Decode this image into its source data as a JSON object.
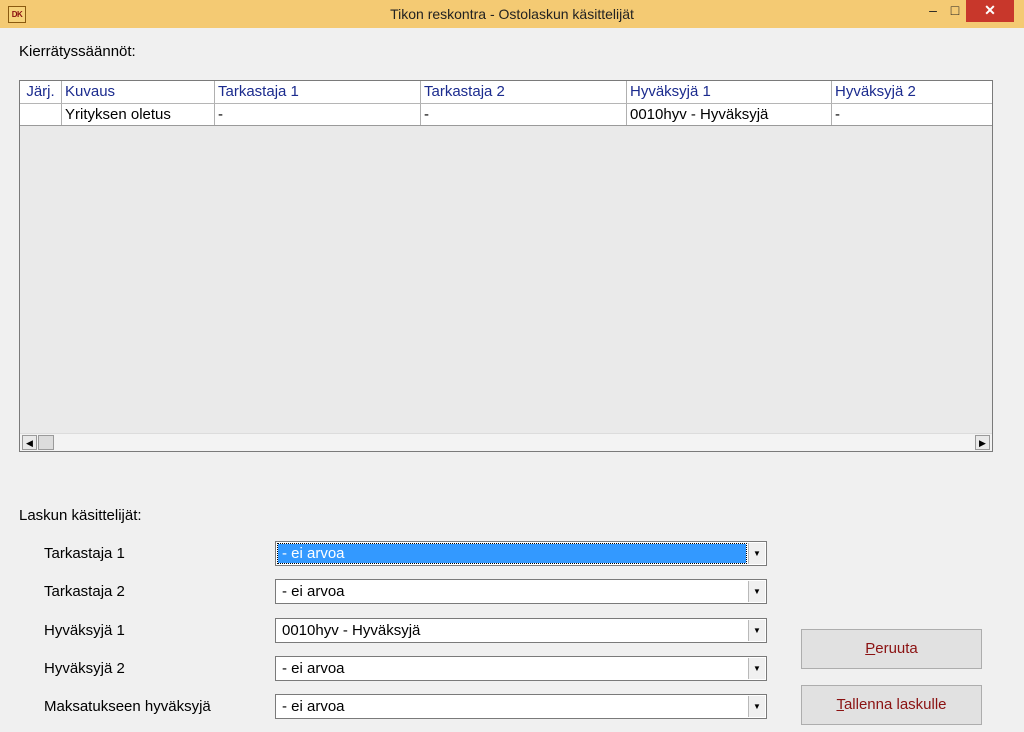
{
  "window": {
    "title": "Tikon reskontra - Ostolaskun käsittelijät",
    "icon_text": "DK",
    "minimize": "–",
    "maximize": "□",
    "close": "✕"
  },
  "rules_label": "Kierrätyssäännöt:",
  "table": {
    "columns": [
      "Järj.",
      "Kuvaus",
      "Tarkastaja 1",
      "Tarkastaja 2",
      "Hyväksyjä 1",
      "Hyväksyjä 2"
    ],
    "rows": [
      [
        "",
        "Yrityksen oletus",
        "-",
        "-",
        "0010hyv - Hyväksyjä",
        "-"
      ]
    ]
  },
  "handlers_label": "Laskun käsittelijät:",
  "fields": [
    {
      "label": "Tarkastaja 1",
      "value": "- ei arvoa"
    },
    {
      "label": "Tarkastaja 2",
      "value": "- ei arvoa"
    },
    {
      "label": "Hyväksyjä 1",
      "value": "0010hyv - Hyväksyjä"
    },
    {
      "label": "Hyväksyjä 2",
      "value": "- ei arvoa"
    },
    {
      "label": "Maksatukseen hyväksyjä",
      "value": "- ei arvoa"
    }
  ],
  "buttons": {
    "cancel_mnemonic": "P",
    "cancel_rest": "eruuta",
    "save_mnemonic": "T",
    "save_rest": "allenna laskulle"
  },
  "icons": {
    "dropdown": "▼",
    "scroll_left": "◀",
    "scroll_right": "▶"
  }
}
